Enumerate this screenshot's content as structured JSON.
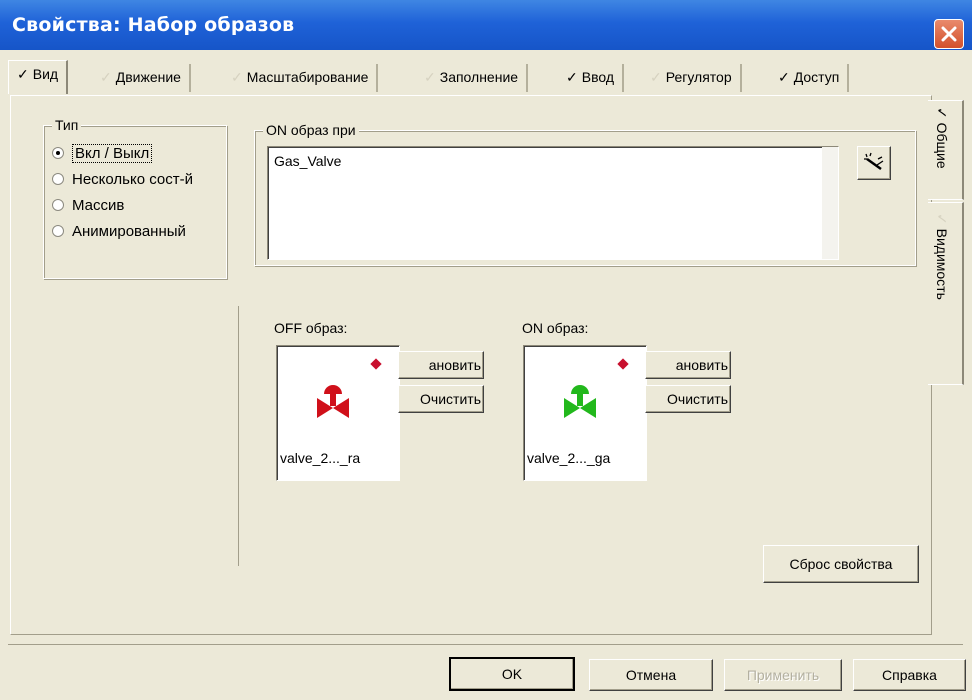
{
  "window": {
    "title": "Свойства: Набор образов"
  },
  "tabs": [
    {
      "label": "Вид",
      "checked": true,
      "active": true
    },
    {
      "label": "Движение",
      "checked": false,
      "active": false
    },
    {
      "label": "Масштабирование",
      "checked": false,
      "active": false
    },
    {
      "label": "Заполнение",
      "checked": false,
      "active": false
    },
    {
      "label": "Ввод",
      "checked": true,
      "active": false
    },
    {
      "label": "Регулятор",
      "checked": false,
      "active": false
    },
    {
      "label": "Доступ",
      "checked": true,
      "active": false
    }
  ],
  "check_glyph": "✓",
  "side_tabs": [
    {
      "label": "Общие",
      "checked": true
    },
    {
      "label": "Видимость",
      "checked": false
    }
  ],
  "type_group": {
    "title": "Тип",
    "options": [
      {
        "label": "Вкл / Выкл",
        "selected": true
      },
      {
        "label": "Несколько сост-й",
        "selected": false
      },
      {
        "label": "Массив",
        "selected": false
      },
      {
        "label": "Анимированный",
        "selected": false
      }
    ]
  },
  "on_image_when": {
    "title": "ON образ при",
    "expression": "Gas_Valve"
  },
  "off_image": {
    "label": "OFF образ:",
    "name": "valve_2..._ra",
    "set_button": "ановить",
    "clear_button": "Очистить",
    "color": "#d0101a"
  },
  "on_image": {
    "label": "ON образ:",
    "name": "valve_2..._ga",
    "set_button": "ановить",
    "clear_button": "Очистить",
    "color": "#22b81c"
  },
  "marker_color": "#c8102e",
  "reset_button": "Сброс свойства",
  "footer": {
    "ok": "OK",
    "cancel": "Отмена",
    "apply": "Применить",
    "help": "Справка"
  }
}
